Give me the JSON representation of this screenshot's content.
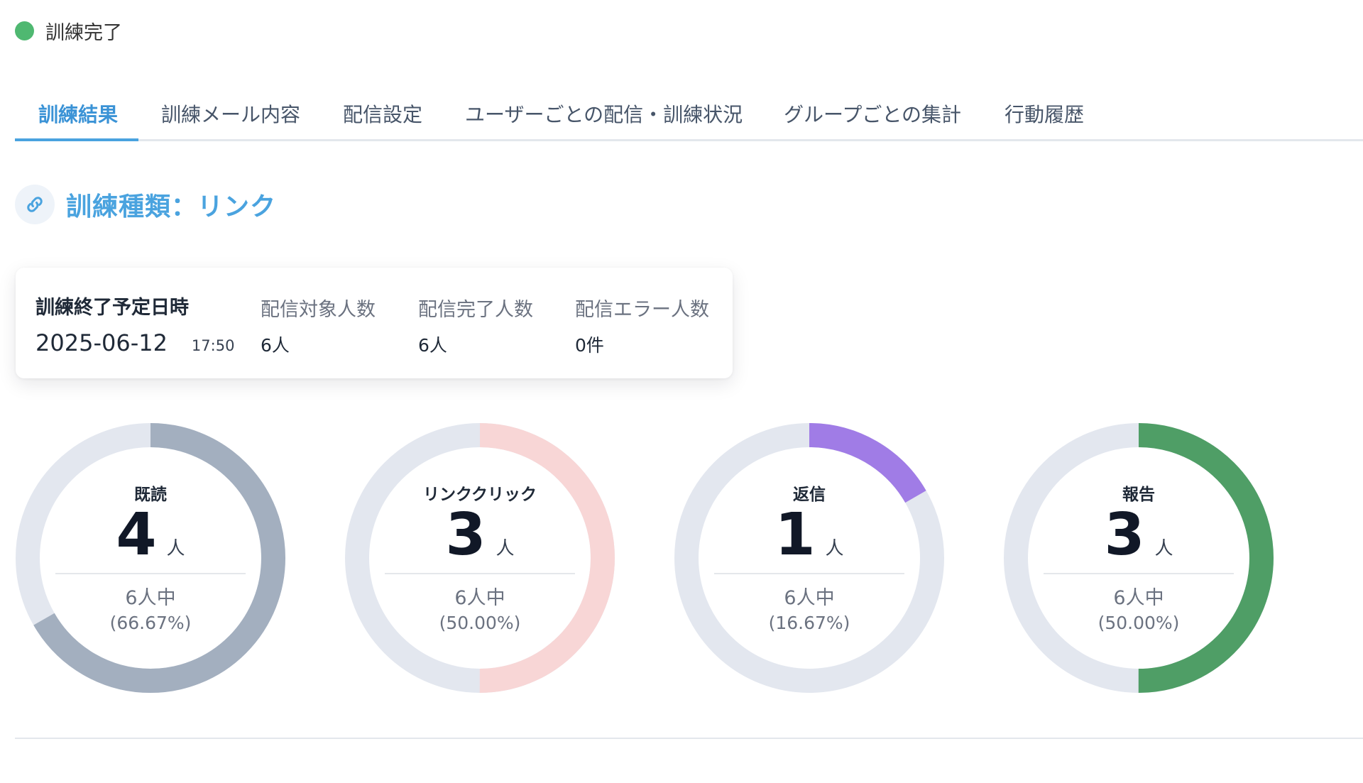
{
  "status": {
    "label": "訓練完了",
    "color": "#4fb871"
  },
  "tabs": [
    {
      "label": "訓練結果",
      "active": true
    },
    {
      "label": "訓練メール内容",
      "active": false
    },
    {
      "label": "配信設定",
      "active": false
    },
    {
      "label": "ユーザーごとの配信・訓練状況",
      "active": false
    },
    {
      "label": "グループごとの集計",
      "active": false
    },
    {
      "label": "行動履歴",
      "active": false
    }
  ],
  "training_type": {
    "icon": "link-icon",
    "title": "訓練種類：リンク"
  },
  "summary": {
    "end_label": "訓練終了予定日時",
    "end_date": "2025-06-12",
    "end_time": "17:50",
    "targets_label": "配信対象人数",
    "targets_value": "6人",
    "completed_label": "配信完了人数",
    "completed_value": "6人",
    "errors_label": "配信エラー人数",
    "errors_value": "0件"
  },
  "metrics": [
    {
      "label": "既読",
      "count": "4",
      "unit": "人",
      "total": "6人中",
      "rate": "(66.67%)",
      "fraction": 0.6667,
      "color": "#a3afbf"
    },
    {
      "label": "リンククリック",
      "count": "3",
      "unit": "人",
      "total": "6人中",
      "rate": "(50.00%)",
      "fraction": 0.5,
      "color": "#f8d6d6"
    },
    {
      "label": "返信",
      "count": "1",
      "unit": "人",
      "total": "6人中",
      "rate": "(16.67%)",
      "fraction": 0.1667,
      "color": "#a07ce6"
    },
    {
      "label": "報告",
      "count": "3",
      "unit": "人",
      "total": "6人中",
      "rate": "(50.00%)",
      "fraction": 0.5,
      "color": "#4f9e66"
    }
  ],
  "track_color": "#e3e7ef"
}
